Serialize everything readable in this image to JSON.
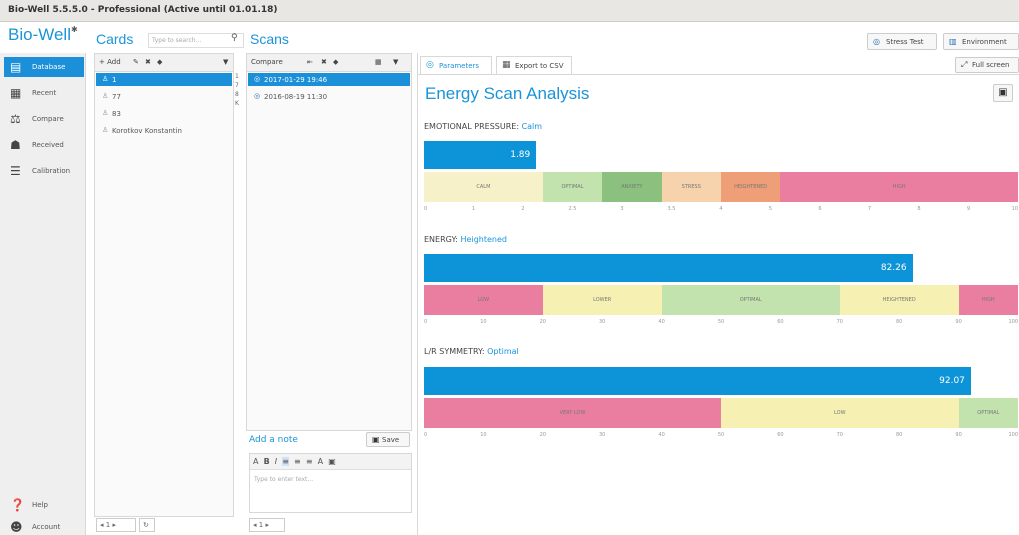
{
  "window": {
    "title": "Bio-Well 5.5.5.0 - Professional (Active until 01.01.18)"
  },
  "logo": "Bio-Well",
  "cards": {
    "title": "Cards",
    "search_placeholder": "Type to search...",
    "add_label": "+ Add",
    "items": [
      {
        "label": "1",
        "selected": true
      },
      {
        "label": "77",
        "selected": false
      },
      {
        "label": "83",
        "selected": false
      },
      {
        "label": "Korotkov Konstantin",
        "selected": false
      }
    ],
    "index_letters": [
      "1",
      "7",
      "8",
      "K"
    ],
    "pager": [
      "◂",
      "1",
      "▸",
      "↻"
    ]
  },
  "scans": {
    "title": "Scans",
    "compare_label": "Compare",
    "items": [
      {
        "label": "2017-01-29 19:46",
        "selected": true
      },
      {
        "label": "2016-08-19 11:30",
        "selected": false
      }
    ],
    "note_link": "Add a note",
    "save_label": "Save",
    "note_placeholder": "Type to enter text...",
    "note_tools": [
      "A",
      "B",
      "I",
      "≡",
      "≡",
      "≡",
      "A",
      "▣"
    ],
    "pager": [
      "◂",
      "1",
      "▸"
    ]
  },
  "sidebar": {
    "items": [
      {
        "label": "Database",
        "icon": "database-icon",
        "active": true
      },
      {
        "label": "Recent",
        "icon": "recent-icon",
        "active": false
      },
      {
        "label": "Compare",
        "icon": "scales-icon",
        "active": false
      },
      {
        "label": "Received",
        "icon": "inbox-icon",
        "active": false
      },
      {
        "label": "Calibration",
        "icon": "calibration-icon",
        "active": false
      }
    ],
    "help_label": "Help",
    "account_label": "Account"
  },
  "header_buttons": {
    "stress_test": "Stress Test",
    "environment": "Environment",
    "full_screen": "Full screen"
  },
  "tabs": [
    {
      "label": "Parameters",
      "active": true
    },
    {
      "label": "Export to CSV",
      "active": false
    }
  ],
  "analysis": {
    "title": "Energy Scan Analysis",
    "metrics": [
      {
        "name": "EMOTIONAL PRESSURE:",
        "status": "Calm",
        "value": 1.89,
        "value_label": "1.89",
        "max": 10,
        "ticks": [
          "0",
          "1",
          "2",
          "2.5",
          "3",
          "3.5",
          "4",
          "5",
          "6",
          "7",
          "8",
          "9",
          "10"
        ],
        "zones": [
          {
            "label": "Calm",
            "from": 0,
            "to": 2,
            "color": "#f6f1c8"
          },
          {
            "label": "Optimal",
            "from": 2,
            "to": 3,
            "color": "#c2e3ad"
          },
          {
            "label": "Anxiety",
            "from": 3,
            "to": 4,
            "color": "#8cc07f"
          },
          {
            "label": "Stress",
            "from": 4,
            "to": 5,
            "color": "#f6d2ad"
          },
          {
            "label": "Heightened",
            "from": 5,
            "to": 6,
            "color": "#ee9f77"
          },
          {
            "label": "High",
            "from": 6,
            "to": 10,
            "color": "#e97ea1"
          }
        ]
      },
      {
        "name": "ENERGY:",
        "status": "Heightened",
        "value": 82.26,
        "value_label": "82.26",
        "max": 100,
        "ticks": [
          "0",
          "10",
          "20",
          "30",
          "40",
          "50",
          "60",
          "70",
          "80",
          "90",
          "100"
        ],
        "zones": [
          {
            "label": "Low",
            "from": 0,
            "to": 20,
            "color": "#e97ea1"
          },
          {
            "label": "Lower",
            "from": 20,
            "to": 40,
            "color": "#f6f1b2"
          },
          {
            "label": "Optimal",
            "from": 40,
            "to": 70,
            "color": "#c2e3ad"
          },
          {
            "label": "Heightened",
            "from": 70,
            "to": 90,
            "color": "#f6f1b2"
          },
          {
            "label": "High",
            "from": 90,
            "to": 100,
            "color": "#e97ea1"
          }
        ]
      },
      {
        "name": "L/R SYMMETRY:",
        "status": "Optimal",
        "value": 92.07,
        "value_label": "92.07",
        "max": 100,
        "ticks": [
          "0",
          "10",
          "20",
          "30",
          "40",
          "50",
          "60",
          "70",
          "80",
          "90",
          "100"
        ],
        "zones": [
          {
            "label": "Very Low",
            "from": 0,
            "to": 50,
            "color": "#e97ea1"
          },
          {
            "label": "Low",
            "from": 50,
            "to": 90,
            "color": "#f6f1b2"
          },
          {
            "label": "Optimal",
            "from": 90,
            "to": 100,
            "color": "#c2e3ad"
          }
        ]
      }
    ]
  }
}
